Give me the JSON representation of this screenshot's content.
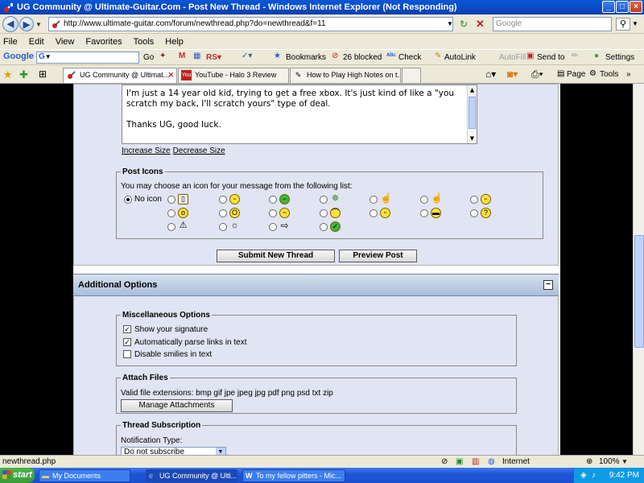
{
  "window": {
    "title": "UG Community @ Ultimate-Guitar.Com - Post New Thread - Windows Internet Explorer (Not Responding)"
  },
  "address": {
    "url": "http://www.ultimate-guitar.com/forum/newthread.php?do=newthread&f=11",
    "search_placeholder": "Google"
  },
  "menu": [
    "File",
    "Edit",
    "View",
    "Favorites",
    "Tools",
    "Help"
  ],
  "google_toolbar": {
    "go": "Go",
    "bookmarks": "Bookmarks",
    "blocked": "26 blocked",
    "check": "Check",
    "autolink": "AutoLink",
    "autofill": "AutoFill",
    "sendto": "Send to",
    "settings": "Settings"
  },
  "tabs": [
    {
      "label": "UG Community @ Ultimat..."
    },
    {
      "label": "YouTube - Halo 3 Review"
    },
    {
      "label": "How to Play High Notes on t..."
    }
  ],
  "command_bar": {
    "page": "Page",
    "tools": "Tools"
  },
  "message": {
    "line1": "I'm just a 14 year old kid, trying to get a free xbox.  It's just kind of like a \"you",
    "line2": "scratch my back, I'll scratch yours\" type of deal.",
    "line3": "Thanks UG, good luck.",
    "increase": "Increase Size",
    "decrease": "Decrease Size"
  },
  "post_icons": {
    "legend": "Post Icons",
    "hint": "You may choose an icon for your message from the following list:",
    "no_icon": "No icon",
    "selected": "no-icon"
  },
  "buttons": {
    "submit": "Submit New Thread",
    "preview": "Preview Post"
  },
  "additional": {
    "header": "Additional Options",
    "collapse": "−",
    "misc_legend": "Miscellaneous Options",
    "show_signature": "Show your signature",
    "parse_links": "Automatically parse links in text",
    "disable_smilies": "Disable smilies in text",
    "attach_legend": "Attach Files",
    "valid_ext": "Valid file extensions: bmp gif jpe jpeg jpg pdf png psd txt zip",
    "manage": "Manage Attachments",
    "subscription_legend": "Thread Subscription",
    "notification_label": "Notification Type:",
    "notification_value": "Do not subscribe"
  },
  "status": {
    "left": "newthread.php",
    "zone": "Internet",
    "zoom": "100%"
  },
  "taskbar": {
    "start": "start",
    "items": [
      {
        "label": "My Documents"
      },
      {
        "label": "UG Community @ Ulti..."
      },
      {
        "label": "To my fellow pitters - Mic..."
      }
    ],
    "clock": "9:42 PM"
  }
}
